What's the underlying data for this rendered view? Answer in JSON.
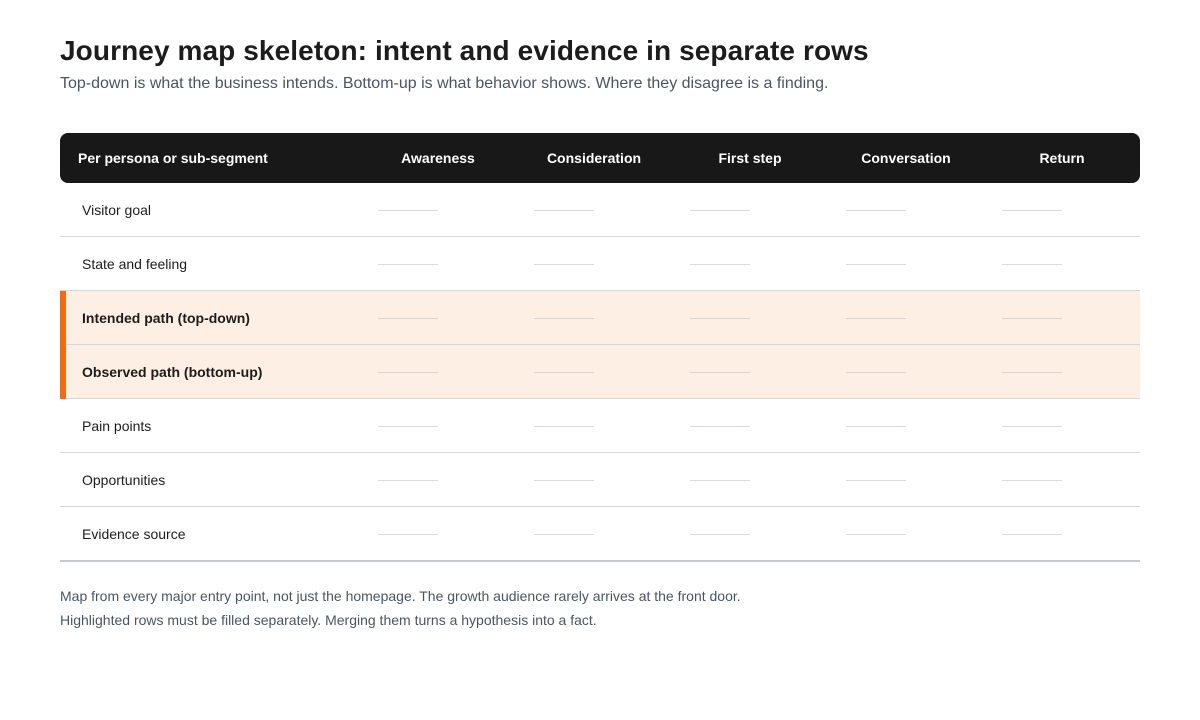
{
  "title": "Journey map skeleton: intent and evidence in separate rows",
  "subtitle": "Top-down is what the business intends. Bottom-up is what behavior shows. Where they disagree is a finding.",
  "table": {
    "corner_header": "Per persona or sub-segment",
    "columns": [
      "Awareness",
      "Consideration",
      "First step",
      "Conversation",
      "Return"
    ],
    "rows": [
      {
        "label": "Visitor goal",
        "highlight": false
      },
      {
        "label": "State and feeling",
        "highlight": false
      },
      {
        "label": "Intended path (top-down)",
        "highlight": true
      },
      {
        "label": "Observed path (bottom-up)",
        "highlight": true
      },
      {
        "label": "Pain points",
        "highlight": false
      },
      {
        "label": "Opportunities",
        "highlight": false
      },
      {
        "label": "Evidence source",
        "highlight": false
      }
    ]
  },
  "footer": {
    "line1": "Map from every major entry point, not just the homepage. The growth audience rarely arrives at the front door.",
    "line2": "Highlighted rows must be filled separately. Merging them turns a hypothesis into a fact."
  },
  "colors": {
    "header_bg": "#181818",
    "highlight_bg": "#fdefe3",
    "accent": "#f26a12",
    "muted_text": "#4a5563"
  }
}
